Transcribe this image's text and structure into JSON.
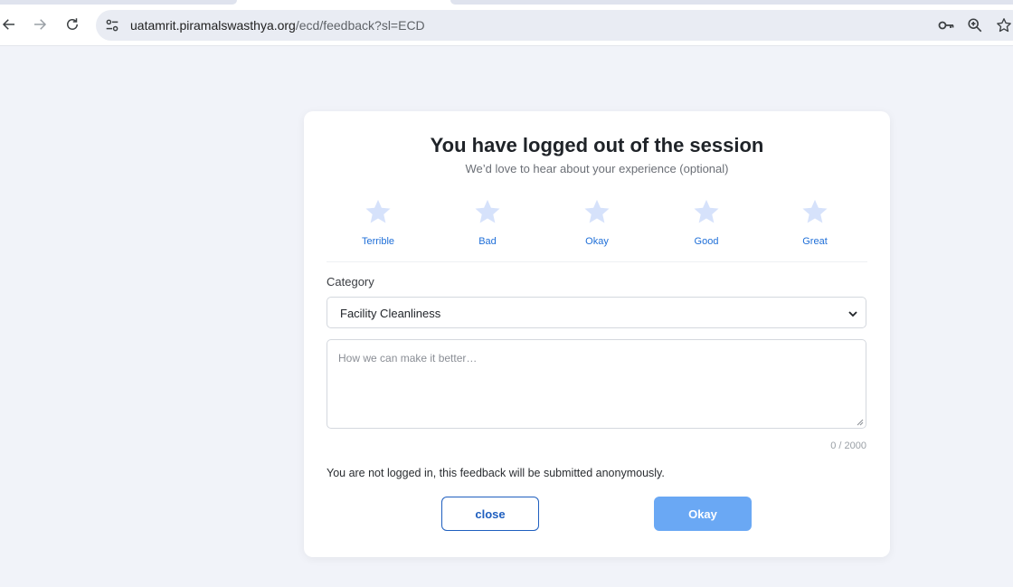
{
  "browser": {
    "url_host": "uatamrit.piramalswasthya.org",
    "url_path": "/ecd/feedback?sl=ECD"
  },
  "dialog": {
    "title": "You have logged out of the session",
    "subtitle": "We’d love to hear about your experience (optional)",
    "ratings": [
      {
        "label": "Terrible"
      },
      {
        "label": "Bad"
      },
      {
        "label": "Okay"
      },
      {
        "label": "Good"
      },
      {
        "label": "Great"
      }
    ],
    "category_label": "Category",
    "category_value": "Facility Cleanliness",
    "comment_placeholder": "How we can make it better…",
    "char_counter": "0 / 2000",
    "anonymous_note": "You are not logged in, this feedback will be submitted anonymously.",
    "close_label": "close",
    "okay_label": "Okay"
  },
  "colors": {
    "star_inactive": "#d6e2fb",
    "link_blue": "#1f6fd8",
    "primary_button": "#6aa8f4"
  }
}
